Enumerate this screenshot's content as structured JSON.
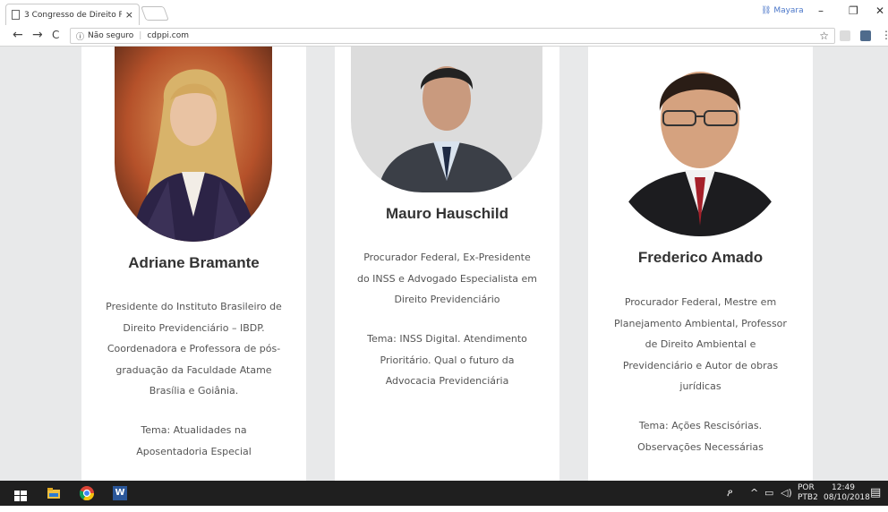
{
  "browser": {
    "tab_title": "3 Congresso de Direito P",
    "tab_close": "×",
    "profile_name": "Mayara",
    "minimize": "–",
    "restore": "❐",
    "close": "✕",
    "back": "←",
    "forward": "→",
    "reload": "C",
    "security_label": "Não seguro",
    "url": "cdppi.com",
    "bookmark_star": "☆",
    "menu": "⋮"
  },
  "speakers": [
    {
      "name": "Adriane Bramante",
      "bio_lines": [
        "Presidente do Instituto Brasileiro de",
        "Direito Previdenciário – IBDP.",
        "Coordenadora e Professora de pós-",
        "graduação da Faculdade Atame",
        "Brasília e Goiânia."
      ],
      "topic_lines": [
        "Tema:  Atualidades na",
        "Aposentadoria Especial"
      ]
    },
    {
      "name": "Mauro Hauschild",
      "bio_lines": [
        "Procurador Federal, Ex-Presidente",
        "do INSS e Advogado Especialista em",
        "Direito Previdenciário"
      ],
      "topic_lines": [
        "Tema: INSS Digital. Atendimento",
        "Prioritário. Qual o futuro da",
        "Advocacia Previdenciária"
      ]
    },
    {
      "name": "Frederico Amado",
      "bio_lines": [
        "Procurador Federal, Mestre em",
        "Planejamento Ambiental, Professor",
        "de Direito Ambiental e",
        "Previdenciário e Autor de obras",
        "jurídicas"
      ],
      "topic_lines": [
        "Tema: Ações Rescisórias.",
        "Observações Necessárias"
      ]
    }
  ],
  "taskbar": {
    "lang_top": "POR",
    "lang_bottom": "PTB2",
    "time": "12:49",
    "date": "08/10/2018",
    "word_label": "W"
  }
}
